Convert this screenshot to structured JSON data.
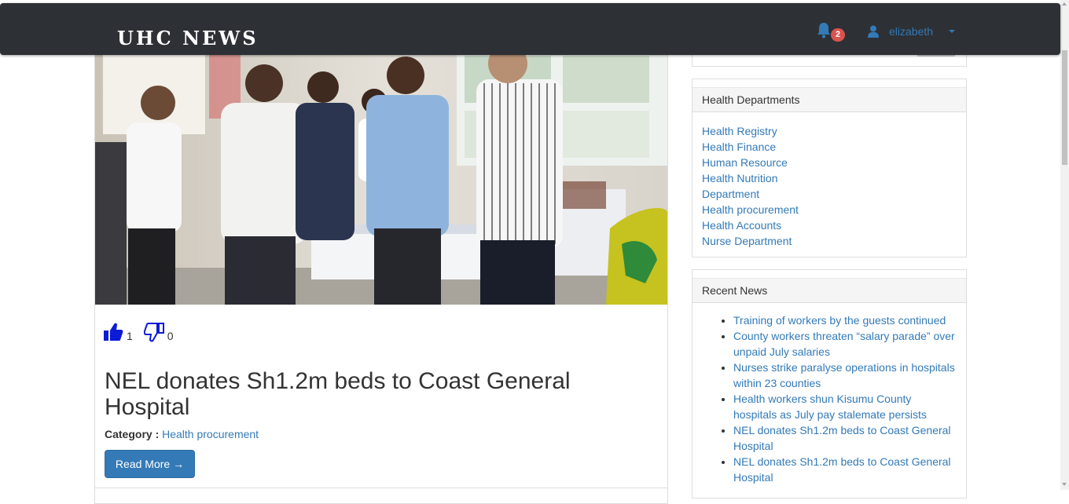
{
  "navbar": {
    "brand": "UHC NEWS",
    "notification_count": "2",
    "username": "elizabeth"
  },
  "article": {
    "likes": "1",
    "dislikes": "0",
    "title": "NEL donates Sh1.2m beds to Coast General Hospital",
    "category_label": "Category :",
    "category": "Health procurement",
    "read_more": "Read More →"
  },
  "sidebar": {
    "departments": {
      "heading": "Health Departments",
      "items": [
        "Health Registry",
        "Health Finance",
        "Human Resource",
        "Health Nutrition Department",
        "Health procurement",
        "Health Accounts",
        "Nurse Department"
      ]
    },
    "recent_news": {
      "heading": "Recent News",
      "items": [
        "Training of workers by the guests continued",
        "County workers threaten “salary parade” over unpaid July salaries",
        "Nurses strike paralyse operations in hospitals within 23 counties",
        "Health workers shun Kisumu County hospitals as July pay stalemate persists",
        "NEL donates Sh1.2m beds to Coast General Hospital",
        "NEL donates Sh1.2m beds to Coast General Hospital"
      ]
    }
  },
  "colors": {
    "navbar_bg": "#2d3035",
    "link": "#337ab7",
    "badge": "#d9534f",
    "vote_icon": "#0b1bd6"
  }
}
